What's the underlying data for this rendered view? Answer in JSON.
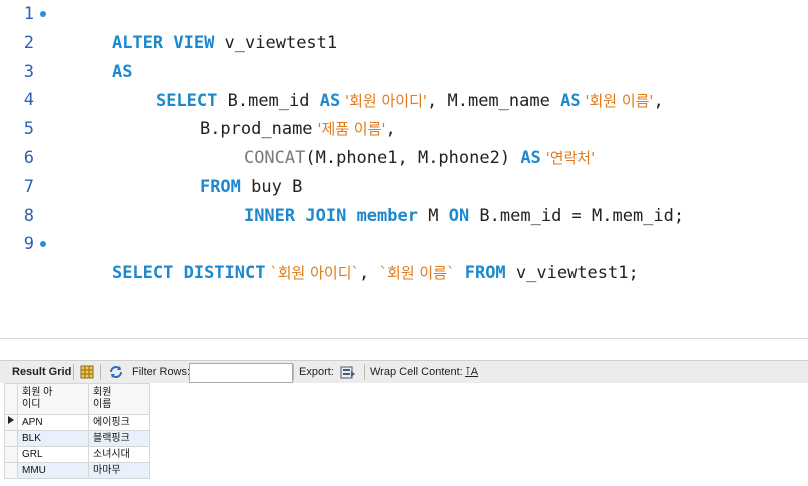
{
  "editor": {
    "lines": [
      {
        "num": "1",
        "marker": true
      },
      {
        "num": "2",
        "marker": false
      },
      {
        "num": "3",
        "marker": false
      },
      {
        "num": "4",
        "marker": false
      },
      {
        "num": "5",
        "marker": false
      },
      {
        "num": "6",
        "marker": false
      },
      {
        "num": "7",
        "marker": false
      },
      {
        "num": "8",
        "marker": false
      },
      {
        "num": "9",
        "marker": true
      }
    ],
    "tokens": {
      "l1_kw": "ALTER VIEW",
      "l1_name": " v_viewtest1",
      "l2_kw": "AS",
      "l3_select": "SELECT",
      "l3_col1": " B.mem_id ",
      "l3_as1": "AS",
      "l3_str1": " '회원 아이디'",
      "l3_col2": ", M.mem_name ",
      "l3_as2": "AS",
      "l3_str2": " '회원 이름'",
      "l3_comma": ",",
      "l4_col": "B.prod_name",
      "l4_str": " '제품 이름'",
      "l4_comma": ",",
      "l5_fn": "CONCAT",
      "l5_args": "(M.phone1, M.phone2) ",
      "l5_as": "AS",
      "l5_str": " '연락처'",
      "l6_from": "FROM",
      "l6_rest": " buy B",
      "l7_join": "INNER JOIN",
      "l7_sp1": " ",
      "l7_member": "member",
      "l7_m": " M ",
      "l7_on": "ON",
      "l7_rest": " B.mem_id = M.mem_id;",
      "l9_kw": "SELECT DISTINCT",
      "l9_str1": " `회원 아이디`",
      "l9_comma": ", ",
      "l9_str2": "`회원 이름`",
      "l9_from": " FROM",
      "l9_rest": " v_viewtest1;"
    }
  },
  "toolbar": {
    "result_grid": "Result Grid",
    "filter_rows": "Filter Rows:",
    "filter_value": "",
    "export": "Export:",
    "wrap": "Wrap Cell Content:",
    "wrap_icon_glyph": "⊺A"
  },
  "grid": {
    "columns": [
      "회원 아\n이디",
      "회원\n이름"
    ],
    "rows": [
      [
        "APN",
        "에이핑크"
      ],
      [
        "BLK",
        "블랙핑크"
      ],
      [
        "GRL",
        "소녀시대"
      ],
      [
        "MMU",
        "마마무"
      ]
    ]
  },
  "colors": {
    "keyword": "#1e88cf",
    "string": "#e07a1b",
    "line_number": "#2f5fb3",
    "alt_row": "#e8f0fb"
  }
}
